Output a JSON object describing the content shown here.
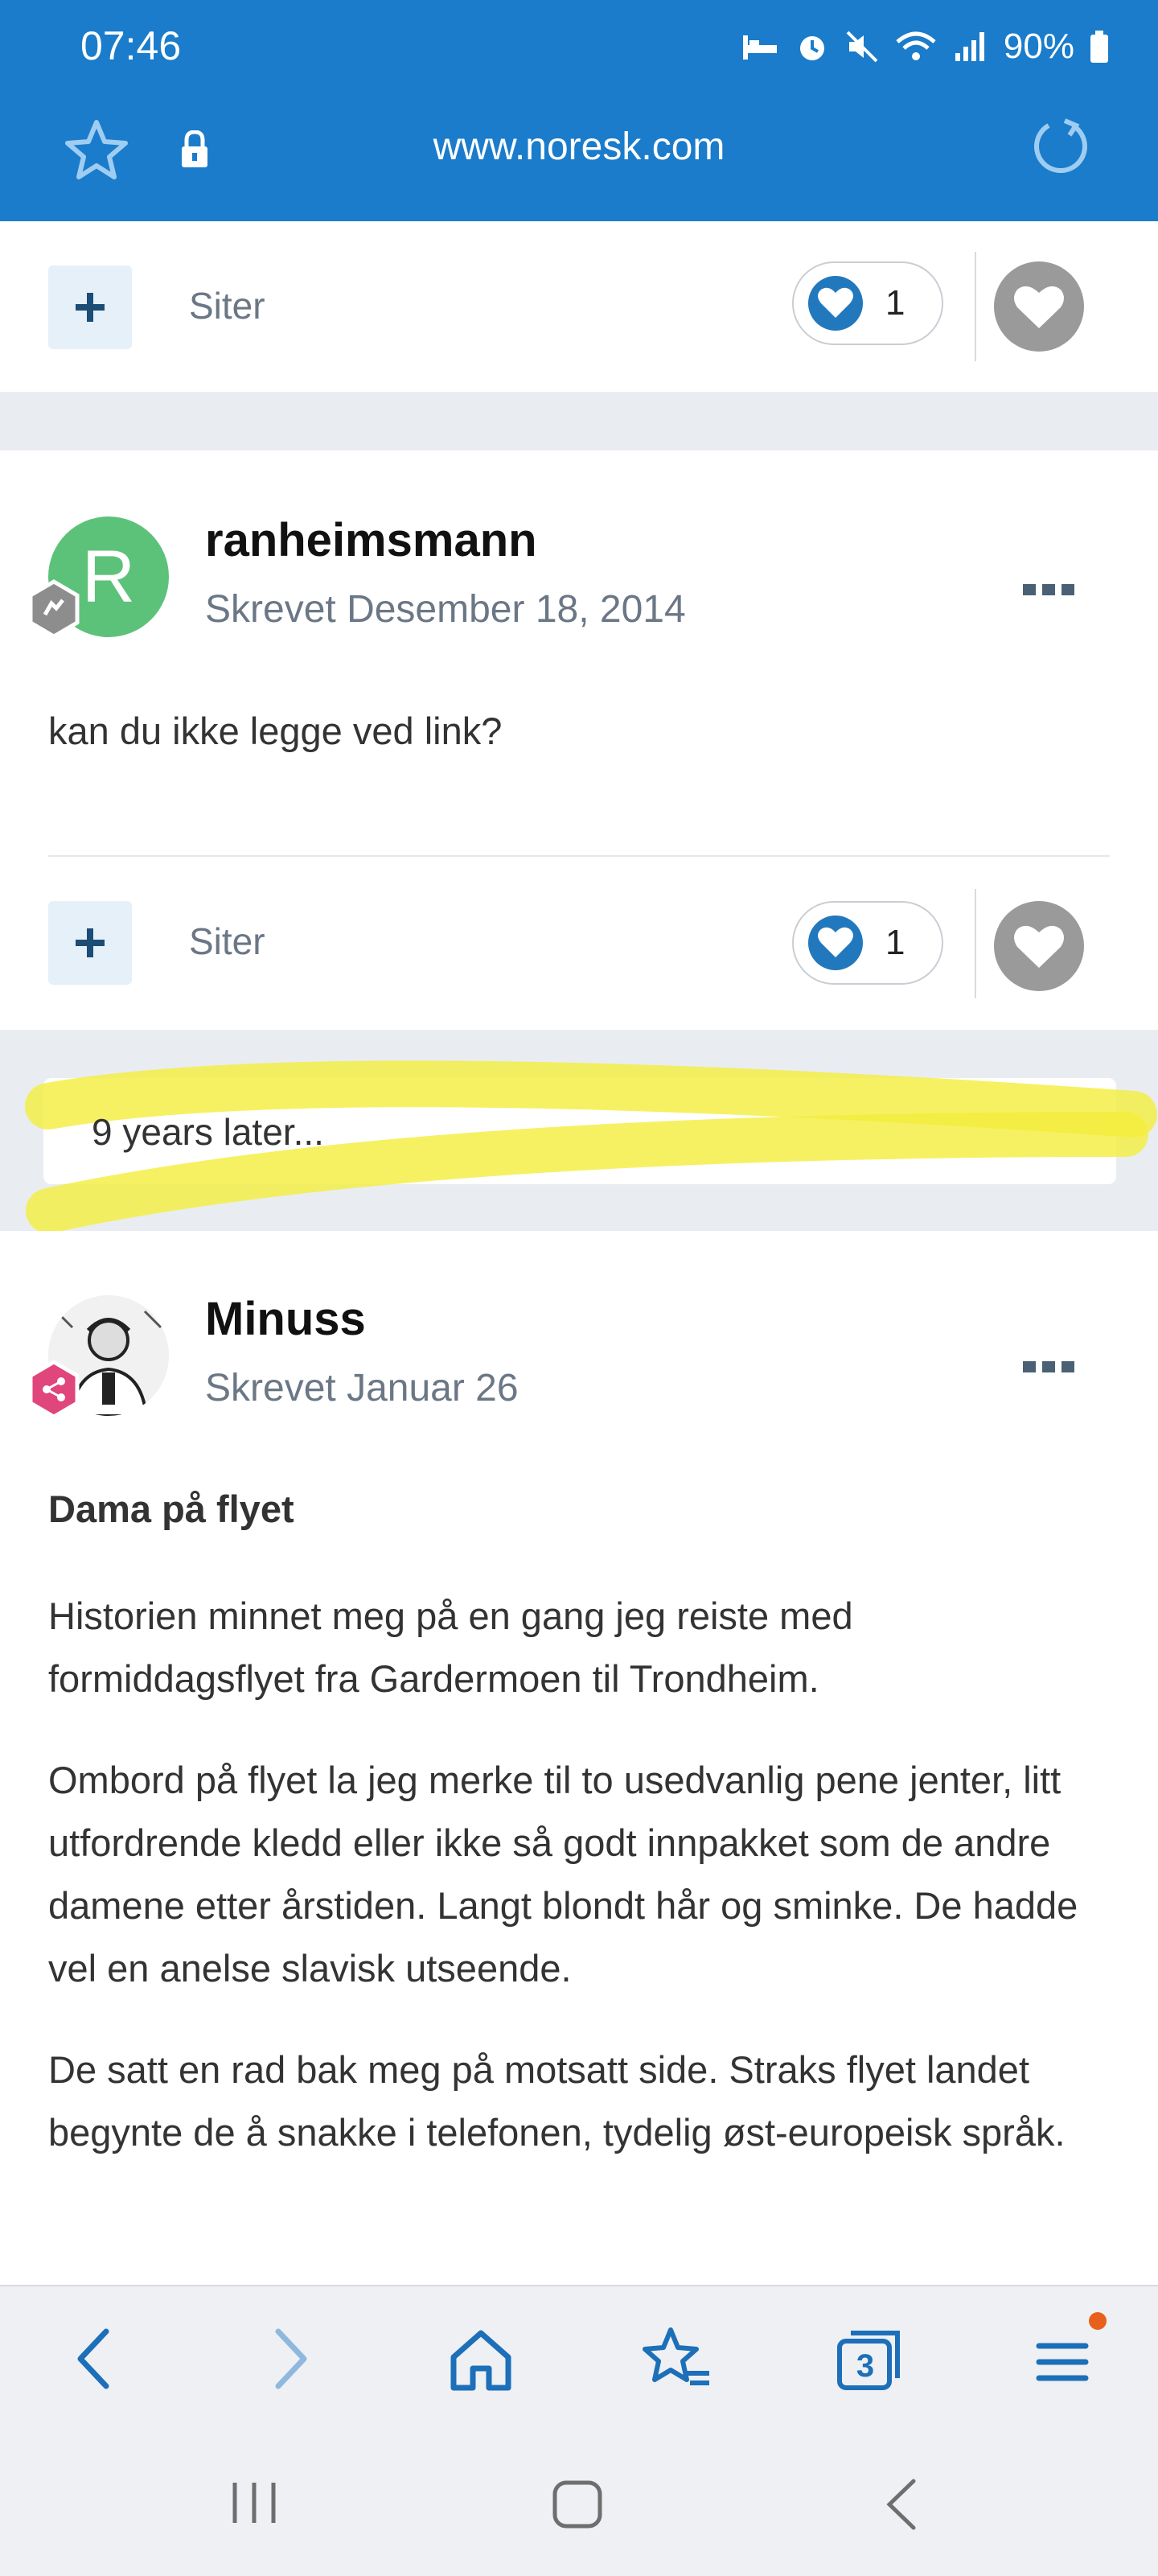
{
  "status": {
    "time": "07:46",
    "battery": "90%"
  },
  "browser": {
    "url": "www.noresk.com"
  },
  "post_prev": {
    "quote_label": "Siter",
    "like_count": "1"
  },
  "post1": {
    "avatar_letter": "R",
    "author": "ranheimsmann",
    "date": "Skrevet Desember 18, 2014",
    "text": "kan du ikke legge ved link?",
    "quote_label": "Siter",
    "like_count": "1"
  },
  "separator": {
    "label": "9 years later..."
  },
  "post2": {
    "author": "Minuss",
    "date": "Skrevet Januar 26",
    "heading": "Dama på flyet",
    "paragraphs": [
      "Historien minnet meg på en gang jeg reiste med formiddagsflyet fra Gardermoen til Trondheim.",
      "Ombord på flyet la jeg merke til to usedvanlig pene jenter, litt utfordrende kledd eller ikke så godt innpakket som de andre damene etter årstiden. Langt blondt hår og sminke. De hadde vel en anelse slavisk utseende.",
      "De satt en rad bak meg på motsatt side. Straks flyet landet begynte de å snakke i telefonen, tydelig øst-europeisk språk."
    ]
  },
  "bottom_nav": {
    "tab_count": "3"
  },
  "colors": {
    "brand_blue": "#1a7ccb",
    "highlight": "#f4ee3c",
    "link_navy": "#1c4d75"
  }
}
